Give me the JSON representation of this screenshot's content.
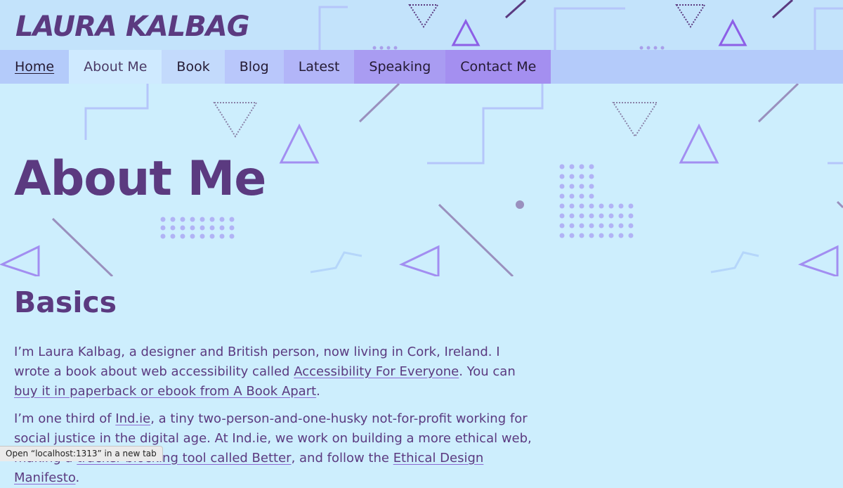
{
  "site": {
    "title": "LAURA KALBAG"
  },
  "nav": {
    "items": [
      {
        "label": "Home"
      },
      {
        "label": "About Me"
      },
      {
        "label": "Book"
      },
      {
        "label": "Blog"
      },
      {
        "label": "Latest"
      },
      {
        "label": "Speaking"
      },
      {
        "label": "Contact Me"
      }
    ]
  },
  "hero": {
    "title": "About Me"
  },
  "section": {
    "title": "Basics",
    "p1": {
      "text1": "I’m Laura Kalbag, a designer and British person, now living in Cork, Ireland. I wrote a book about web accessibility called ",
      "link1": "Accessibility For Everyone",
      "text2": ". You can ",
      "link2": "buy it in paperback or ebook from A Book Apart",
      "text3": "."
    },
    "p2": {
      "text1": "I’m one third of ",
      "link1": "Ind.ie",
      "text2": ", a tiny two-person-and-one-husky not-for-profit working for social justice in the digital age. At Ind.ie, we work on building a more ethical web, making a ",
      "link2": "tracker-blocking tool called Better",
      "text3": ", and follow the ",
      "link3": "Ethical Design Manifesto",
      "text4": "."
    }
  },
  "status": {
    "text": "Open “localhost:1313” in a new tab"
  },
  "colors": {
    "accent": "#5b3a80",
    "background": "#cdeefd",
    "nav": "#b4cbfa"
  }
}
